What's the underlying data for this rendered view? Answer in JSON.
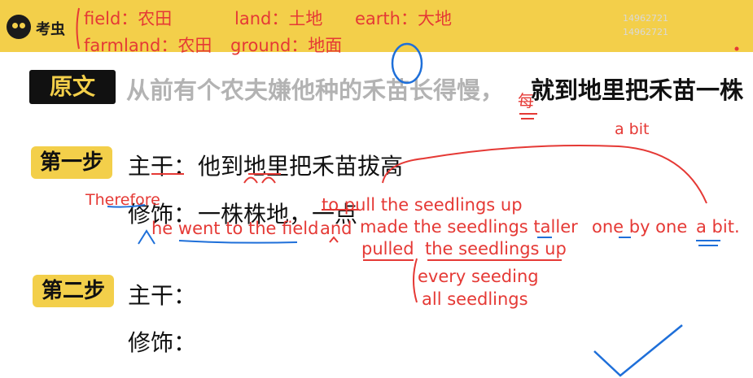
{
  "app": {
    "logo_text": "考虫"
  },
  "vocab": {
    "line1": [
      "field：农田",
      "land：土地",
      "earth：大地"
    ],
    "line2": [
      "farmland：农田",
      "ground：地面"
    ]
  },
  "watermark": [
    "14962721",
    "14962721"
  ],
  "original": {
    "label": "原文",
    "text_gray": "从前有个农夫嫌他种的禾苗长得慢，",
    "text_black": "就到地里把禾苗一株"
  },
  "step1": {
    "badge": "第一步",
    "trunk_label": "主干：",
    "trunk_text": "他到地里把禾苗拔高",
    "mod_label": "修饰：",
    "mod_text": "一株株地，一点"
  },
  "step2": {
    "badge": "第二步",
    "trunk_label": "主干：",
    "mod_label": "修饰："
  },
  "annotations": {
    "mei": "每",
    "a_bit_top": "a bit",
    "therefore": "Therefore",
    "to_pull": "to pull the seedlings up",
    "he_went": "he went to the field",
    "and": "and",
    "made_taller": "made the seedlings taller",
    "one_by_one": "one by one",
    "a_bit": "a bit.",
    "pulled": "pulled",
    "seedlings_up": "the seedlings up",
    "every_seeding": "every seeding",
    "all_seedlings": "all seedlings"
  },
  "colors": {
    "brand_yellow": "#f3cf4a",
    "ink_red": "#e53935",
    "ink_blue": "#1e6fd9"
  }
}
